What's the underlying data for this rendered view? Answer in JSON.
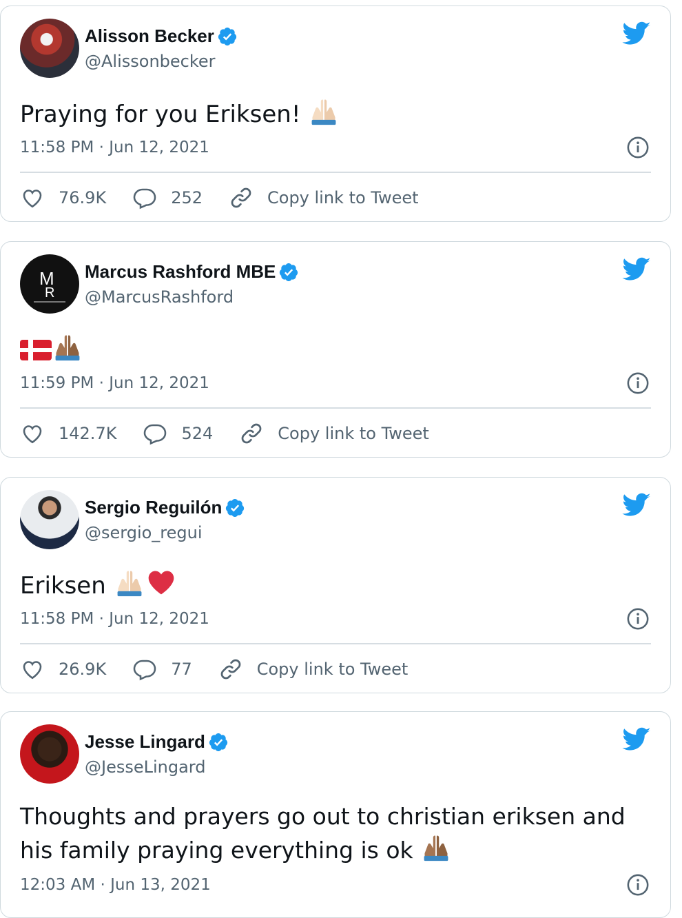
{
  "tweets": [
    {
      "name": "Alisson Becker",
      "handle": "@Alissonbecker",
      "text": "Praying for you Eriksen! ",
      "emojis": [
        "folded-hands-light"
      ],
      "time": "11:58 PM · Jun 12, 2021",
      "likes": "76.9K",
      "replies": "252",
      "copy_link": "Copy link to Tweet"
    },
    {
      "name": "Marcus Rashford MBE",
      "handle": "@MarcusRashford",
      "text": "",
      "emojis": [
        "flag-denmark",
        "folded-hands-medium"
      ],
      "time": "11:59 PM · Jun 12, 2021",
      "likes": "142.7K",
      "replies": "524",
      "copy_link": "Copy link to Tweet"
    },
    {
      "name": "Sergio Reguilón",
      "handle": "@sergio_regui",
      "text": "Eriksen ",
      "emojis": [
        "folded-hands-light",
        "red-heart"
      ],
      "time": "11:58 PM · Jun 12, 2021",
      "likes": "26.9K",
      "replies": "77",
      "copy_link": "Copy link to Tweet"
    },
    {
      "name": "Jesse Lingard",
      "handle": "@JesseLingard",
      "text": "Thoughts and prayers go out to christian eriksen and his family praying everything is ok ",
      "emojis": [
        "folded-hands-medium"
      ],
      "time": "12:03 AM · Jun 13, 2021"
    }
  ],
  "colors": {
    "verified": "#1d9bf0",
    "twitter_blue": "#1d9bf0",
    "muted": "#536471",
    "heart": "#e0245e"
  }
}
